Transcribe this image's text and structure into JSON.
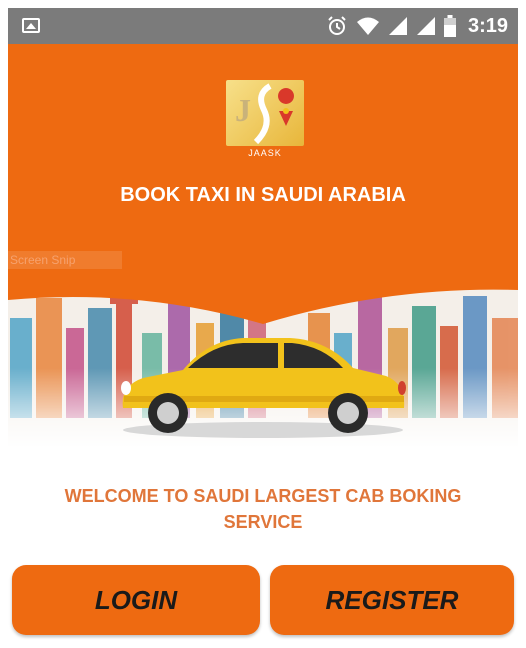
{
  "status_bar": {
    "time": "3:19",
    "icons": [
      "image-icon",
      "alarm-icon",
      "wifi-icon",
      "signal-icon",
      "signal-icon",
      "battery-icon"
    ]
  },
  "header": {
    "logo_text": "J",
    "logo_subtext": "JAASK",
    "title": "BOOK TAXI IN SAUDI ARABIA",
    "overlay_text": "Screen Snip"
  },
  "main": {
    "welcome": "WELCOME TO SAUDI LARGEST CAB BOKING SERVICE"
  },
  "buttons": {
    "login": "LOGIN",
    "register": "REGISTER"
  },
  "colors": {
    "primary": "#ee6a11",
    "status_bar": "#7b7b7b",
    "welcome_text": "#e0763a",
    "car": "#f2c21b"
  }
}
